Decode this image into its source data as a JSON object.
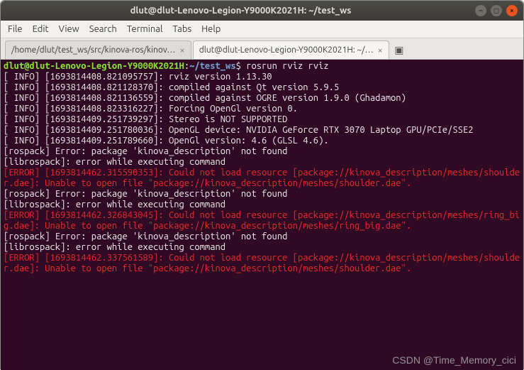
{
  "window": {
    "title": "dlut@dlut-Lenovo-Legion-Y9000K2021H: ~/test_ws"
  },
  "menu": {
    "items": [
      "File",
      "Edit",
      "View",
      "Search",
      "Terminal",
      "Tabs",
      "Help"
    ]
  },
  "tabs": [
    {
      "label": "/home/dlut/test_ws/src/kinova-ros/kinov…",
      "active": false
    },
    {
      "label": "dlut@dlut-Lenovo-Legion-Y9000K2021H: ~/…",
      "active": true
    }
  ],
  "prompt": {
    "userhost": "dlut@dlut-Lenovo-Legion-Y9000K2021H",
    "colon": ":",
    "cwd": "~/test_ws",
    "dollar": "$ ",
    "command": "rosrun rviz rviz"
  },
  "lines": [
    {
      "cls": "w",
      "text": "[ INFO] [1693814408.821095757]: rviz version 1.13.30"
    },
    {
      "cls": "w",
      "text": "[ INFO] [1693814408.821128370]: compiled against Qt version 5.9.5"
    },
    {
      "cls": "w",
      "text": "[ INFO] [1693814408.821136559]: compiled against OGRE version 1.9.0 (Ghadamon)"
    },
    {
      "cls": "w",
      "text": "[ INFO] [1693814408.823316227]: Forcing OpenGl version 0."
    },
    {
      "cls": "w",
      "text": "[ INFO] [1693814409.251739297]: Stereo is NOT SUPPORTED"
    },
    {
      "cls": "w",
      "text": "[ INFO] [1693814409.251780036]: OpenGL device: NVIDIA GeForce RTX 3070 Laptop GPU/PCIe/SSE2"
    },
    {
      "cls": "w",
      "text": "[ INFO] [1693814409.251789660]: OpenGl version: 4.6 (GLSL 4.6)."
    },
    {
      "cls": "w",
      "text": "[rospack] Error: package 'kinova_description' not found"
    },
    {
      "cls": "w",
      "text": "[librospack]: error while executing command"
    },
    {
      "cls": "r",
      "text": "[ERROR] [1693814462.315590353]: Could not load resource [package://kinova_description/meshes/shoulder.dae]: Unable to open file \"package://kinova_description/meshes/shoulder.dae\"."
    },
    {
      "cls": "w",
      "text": "[rospack] Error: package 'kinova_description' not found"
    },
    {
      "cls": "w",
      "text": "[librospack]: error while executing command"
    },
    {
      "cls": "r",
      "text": "[ERROR] [1693814462.326843045]: Could not load resource [package://kinova_description/meshes/ring_big.dae]: Unable to open file \"package://kinova_description/meshes/ring_big.dae\"."
    },
    {
      "cls": "w",
      "text": "[rospack] Error: package 'kinova_description' not found"
    },
    {
      "cls": "w",
      "text": "[librospack]: error while executing command"
    },
    {
      "cls": "r",
      "text": "[ERROR] [1693814462.337561589]: Could not load resource [package://kinova_description/meshes/shoulder.dae]: Unable to open file \"package://kinova_description/meshes/shoulder.dae\"."
    }
  ],
  "watermark": "CSDN @Time_Memory_cici"
}
